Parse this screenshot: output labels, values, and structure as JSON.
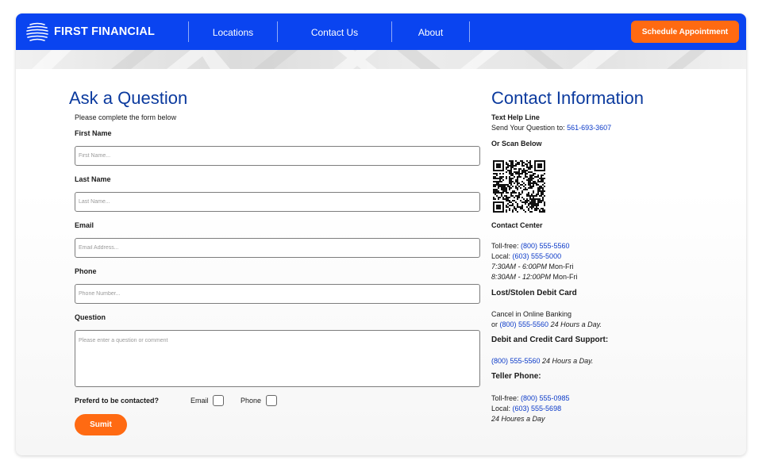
{
  "brand": {
    "name": "FIRST FINANCIAL"
  },
  "nav": {
    "items": [
      "Locations",
      "Contact Us",
      "About"
    ],
    "cta_label": "Schedule Appointment"
  },
  "form": {
    "title": "Ask a Question",
    "intro": "Please complete the form below",
    "first_name": {
      "label": "First Name",
      "placeholder": "First Name..."
    },
    "last_name": {
      "label": "Last Name",
      "placeholder": "Last Name..."
    },
    "email": {
      "label": "Email",
      "placeholder": "Email Address..."
    },
    "phone": {
      "label": "Phone",
      "placeholder": "Phone Number..."
    },
    "question": {
      "label": "Question",
      "placeholder": "Please enter a question or comment"
    },
    "contact_pref": {
      "label": "Preferd to be contacted?",
      "options": [
        "Email",
        "Phone"
      ]
    },
    "submit_label": "Sumit"
  },
  "contact": {
    "title": "Contact Information",
    "text_help": {
      "heading": "Text Help Line",
      "prefix": "Send Your Question to: ",
      "number": "561-693-3607"
    },
    "scan_label": "Or Scan Below",
    "center": {
      "heading": "Contact Center",
      "tollfree_prefix": "Toll-free: ",
      "tollfree": "(800) 555-5560",
      "local_prefix": "Local: ",
      "local": "(603) 555-5000",
      "hours1_time": "7:30AM - 6:00PM",
      "hours1_days": " Mon-Fri",
      "hours2_time": "8:30AM - 12:00PM",
      "hours2_days": " Mon-Fri"
    },
    "lost_card": {
      "heading": "Lost/Stolen Debit Card",
      "line1": "Cancel in Online Banking",
      "or_prefix": "or ",
      "number": "(800) 555-5560",
      "availability": " 24 Hours a Day."
    },
    "card_support": {
      "heading": "Debit and Credit Card Support:",
      "number": "(800) 555-5560",
      "availability": " 24 Hours a Day."
    },
    "teller": {
      "heading": "Teller Phone:",
      "tollfree_prefix": "Toll-free: ",
      "tollfree": "(800) 555-0985",
      "local_prefix": "Local: ",
      "local": "(603) 555-5698",
      "availability": "24 Houres a Day"
    }
  },
  "colors": {
    "nav_blue": "#0a44f0",
    "accent_orange": "#ff6a12",
    "heading_blue": "#0b3a9e",
    "link_blue": "#0b3ac8"
  }
}
